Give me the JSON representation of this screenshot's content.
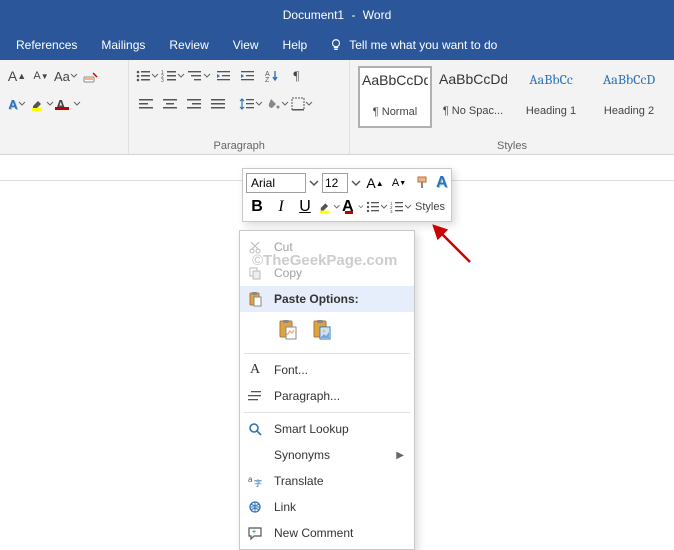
{
  "title": {
    "doc": "Document1",
    "app": "Word"
  },
  "tabs": {
    "references": "References",
    "mailings": "Mailings",
    "review": "Review",
    "view": "View",
    "help": "Help",
    "tell": "Tell me what you want to do"
  },
  "ribbon": {
    "paragraph_label": "Paragraph",
    "styles_label": "Styles"
  },
  "styles": [
    {
      "sample": "AaBbCcDd",
      "name": "¶ Normal",
      "heading": false,
      "selected": true
    },
    {
      "sample": "AaBbCcDd",
      "name": "¶ No Spac...",
      "heading": false,
      "selected": false
    },
    {
      "sample": "AaBbCc",
      "name": "Heading 1",
      "heading": true,
      "selected": false
    },
    {
      "sample": "AaBbCcD",
      "name": "Heading 2",
      "heading": true,
      "selected": false
    }
  ],
  "mini": {
    "font_name": "Arial",
    "font_size": "12",
    "styles_label": "Styles"
  },
  "ctx": {
    "cut": "Cut",
    "copy": "Copy",
    "paste_options": "Paste Options:",
    "font": "Font...",
    "paragraph": "Paragraph...",
    "smart_lookup": "Smart Lookup",
    "synonyms": "Synonyms",
    "translate": "Translate",
    "link": "Link",
    "new_comment": "New Comment"
  },
  "watermark": "©TheGeekPage.com"
}
